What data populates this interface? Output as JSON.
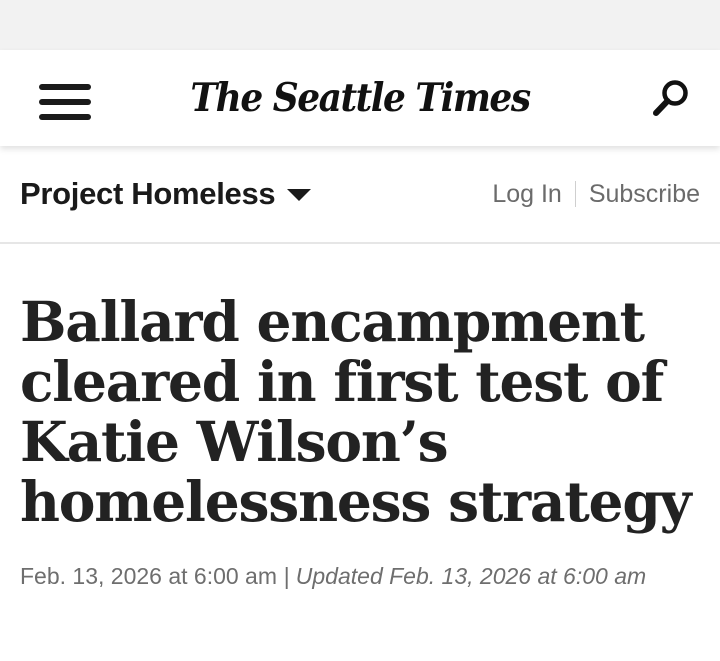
{
  "header": {
    "logo_text": "The Seattle Times",
    "menu_icon": "hamburger-menu-icon",
    "search_icon": "search-icon"
  },
  "section_bar": {
    "section_name": "Project Homeless",
    "login_label": "Log In",
    "subscribe_label": "Subscribe"
  },
  "article": {
    "headline": "Ballard encampment cleared in first test of Katie Wilson’s homelessness strategy",
    "published": "Feb. 13, 2026 at 6:00 am",
    "separator": " | ",
    "updated": "Updated Feb. 13, 2026 at 6:00 am"
  },
  "colors": {
    "text_dark": "#222222",
    "text_muted": "#6e6e6e",
    "status_strip": "#f2f2f2"
  }
}
